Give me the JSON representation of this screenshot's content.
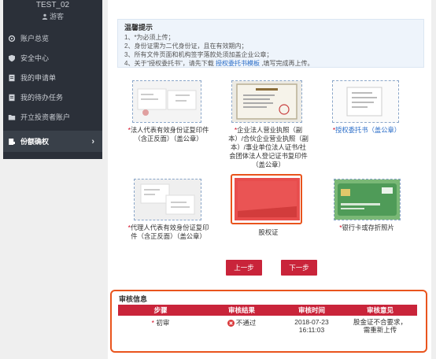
{
  "user": {
    "name": "TEST_02",
    "role": "游客"
  },
  "nav": [
    {
      "label": "账户总览",
      "icon": "gear-icon"
    },
    {
      "label": "安全中心",
      "icon": "shield-icon"
    },
    {
      "label": "我的申请单",
      "icon": "document-icon"
    },
    {
      "label": "我的待办任务",
      "icon": "document-icon"
    },
    {
      "label": "开立投资者账户",
      "icon": "folder-icon"
    },
    {
      "label": "份额确权",
      "icon": "key-icon",
      "active": true
    }
  ],
  "tip": {
    "title": "温馨提示",
    "lines": [
      "1、*为必须上传；",
      "2、身份证需为二代身份证，且在有效期内；",
      "3、所有文件页面和机构签字落款处须加盖企业公章；"
    ],
    "line4_pre": "4、关于“授权委托书”，请先下载 ",
    "line4_link": "授权委托书模板",
    "line4_post": " ,填写完成再上传。"
  },
  "docs": {
    "d1": {
      "req": "*",
      "text": "法人代表有效身份证复印件（含正反面）（盖公章）"
    },
    "d2": {
      "req": "*",
      "text": "企业法人营业执照（副本）/合伙企业营业执照（副本）/事业单位法人证书/社会团体法人登记证书复印件（盖公章）"
    },
    "d3": {
      "req": "*",
      "text": "授权委托书（盖公章）"
    },
    "d4": {
      "req": "*",
      "text": "代理人代表有效身份证复印件（含正反面）（盖公章）"
    },
    "d5": {
      "req": "",
      "text": "股权证"
    },
    "d6": {
      "req": "*",
      "text": "银行卡或存折照片"
    }
  },
  "buttons": {
    "prev": "上一步",
    "next": "下一步"
  },
  "audit": {
    "title": "审核信息",
    "headers": [
      "步骤",
      "审核结果",
      "审核时间",
      "审核意见"
    ],
    "row": {
      "step_req": "*",
      "step": "初审",
      "result": "不通过",
      "time_date": "2018-07-23",
      "time_clock": "16:11:03",
      "opinion": "股金证不合要求，需重新上传"
    }
  },
  "colors": {
    "brand_red": "#c9243a",
    "highlight_orange": "#e9541d",
    "link_blue": "#2d6fc9",
    "sidebar_bg": "#2b3039"
  }
}
